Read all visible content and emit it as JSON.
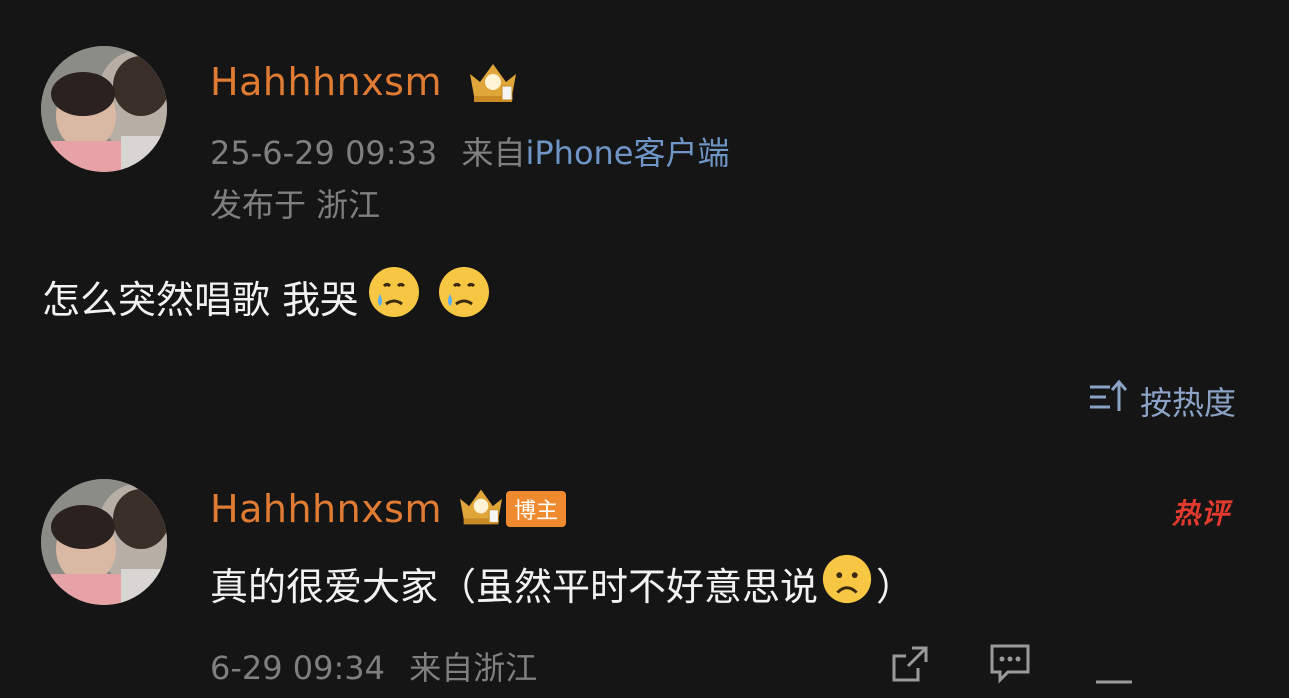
{
  "post": {
    "username": "Hahhhnxsm",
    "time": "25-6-29 09:33",
    "source_prefix": "来自",
    "source": "iPhone客户端",
    "location": "发布于 浙江",
    "content": "怎么突然唱歌 我哭",
    "emoji": [
      "crying-face-emoji",
      "crying-face-emoji"
    ]
  },
  "sort": {
    "label": "按热度",
    "icon": "sort-icon"
  },
  "comment": {
    "username": "Hahhhnxsm",
    "badge": "博主",
    "hot_tag": "热评",
    "content_pre": "真的很爱大家（虽然平时不好意思说",
    "content_post": "）",
    "emoji": "frowning-face-emoji",
    "time": "6-29 09:34",
    "source": "来自浙江",
    "actions": [
      "share-icon",
      "comment-icon",
      "like-icon"
    ]
  },
  "colors": {
    "background": "#151515",
    "username": "#e07b33",
    "link": "#6f95c6",
    "meta": "#7f7f7f",
    "hot": "#e23a2e"
  }
}
